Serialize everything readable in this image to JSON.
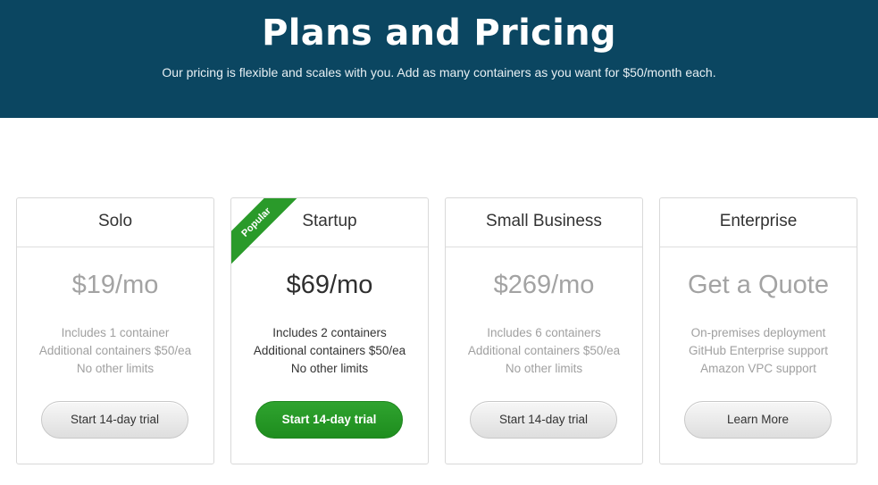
{
  "header": {
    "title": "Plans and Pricing",
    "subtitle": "Our pricing is flexible and scales with you. Add as many containers as you want for $50/month each."
  },
  "plans": [
    {
      "name": "Solo",
      "price": "$19/mo",
      "features": [
        "Includes 1 container",
        "Additional containers $50/ea",
        "No other limits"
      ],
      "button": "Start 14-day trial"
    },
    {
      "name": "Startup",
      "badge": "Popular",
      "price": "$69/mo",
      "features": [
        "Includes 2 containers",
        "Additional containers $50/ea",
        "No other limits"
      ],
      "button": "Start 14-day trial"
    },
    {
      "name": "Small Business",
      "price": "$269/mo",
      "features": [
        "Includes 6 containers",
        "Additional containers $50/ea",
        "No other limits"
      ],
      "button": "Start 14-day trial"
    },
    {
      "name": "Enterprise",
      "price": "Get a Quote",
      "features": [
        "On-premises deployment",
        "GitHub Enterprise support",
        "Amazon VPC support"
      ],
      "button": "Learn More"
    }
  ],
  "colors": {
    "header_bg": "#0b4661",
    "featured_green": "#2a9a2a",
    "muted_text": "#a0a0a0"
  }
}
